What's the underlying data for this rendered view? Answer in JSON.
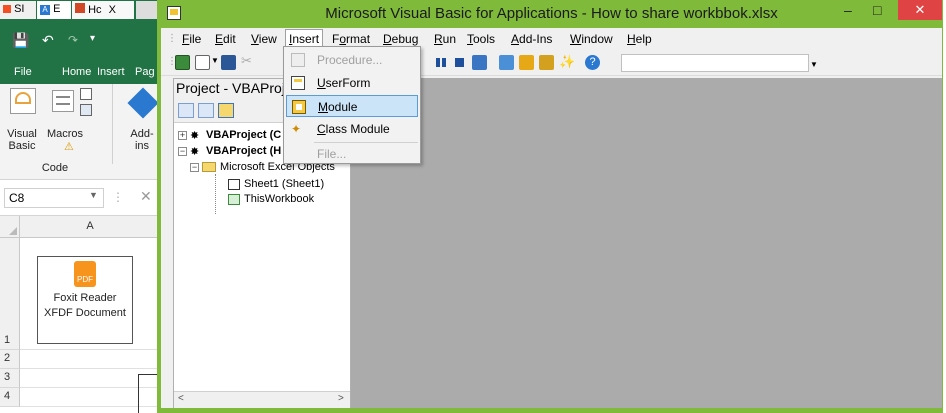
{
  "excel": {
    "taskbar_tabs": [
      "SI",
      "E",
      "Hc",
      "X"
    ],
    "ribbon_tabs": [
      "File",
      "Home",
      "Insert",
      "Pag"
    ],
    "ribbon_buttons": [
      {
        "label": "Visual\nBasic"
      },
      {
        "label": "Macros"
      },
      {
        "label": "Add-\nins"
      }
    ],
    "group_label": "Code",
    "name_box": "C8",
    "column_header": "A",
    "embedded_object": {
      "label": "Foxit Reader XFDF Document",
      "badge": "PDF"
    },
    "row_numbers": [
      "1",
      "2",
      "3",
      "4"
    ]
  },
  "vba": {
    "title": "Microsoft Visual Basic for Applications - How to share workbbok.xlsx",
    "window_buttons": {
      "minimize": "–",
      "maximize": "□",
      "close": "✕"
    },
    "menu": [
      {
        "label": "File",
        "key": "F"
      },
      {
        "label": "Edit",
        "key": "E"
      },
      {
        "label": "View",
        "key": "V"
      },
      {
        "label": "Insert",
        "key": "I"
      },
      {
        "label": "Format",
        "key": "o"
      },
      {
        "label": "Debug",
        "key": "D"
      },
      {
        "label": "Run",
        "key": "R"
      },
      {
        "label": "Tools",
        "key": "T"
      },
      {
        "label": "Add-Ins",
        "key": "A"
      },
      {
        "label": "Window",
        "key": "W"
      },
      {
        "label": "Help",
        "key": "H"
      }
    ],
    "project_panel": {
      "title": "Project - VBAProje",
      "tree": [
        {
          "label": "VBAProject (C",
          "bold": true
        },
        {
          "label": "VBAProject (H",
          "bold": true
        },
        {
          "label": "Microsoft Excel Objects",
          "bold": false
        },
        {
          "label": "Sheet1 (Sheet1)",
          "bold": false
        },
        {
          "label": "ThisWorkbook",
          "bold": false
        }
      ]
    },
    "insert_menu": [
      {
        "label": "Procedure...",
        "enabled": false,
        "icon": "procedure-icon"
      },
      {
        "label": "UserForm",
        "enabled": true,
        "icon": "userform-icon"
      },
      {
        "label": "Module",
        "enabled": true,
        "highlighted": true,
        "icon": "module-icon"
      },
      {
        "label": "Class Module",
        "enabled": true,
        "icon": "class-module-icon"
      },
      {
        "label": "File...",
        "enabled": false,
        "icon": null
      }
    ]
  },
  "colors": {
    "excel_green": "#217346",
    "vba_frame_green": "#7fba3a",
    "close_red": "#e04343",
    "highlight_blue": "#cce4f7",
    "code_area_gray": "#ababab"
  }
}
